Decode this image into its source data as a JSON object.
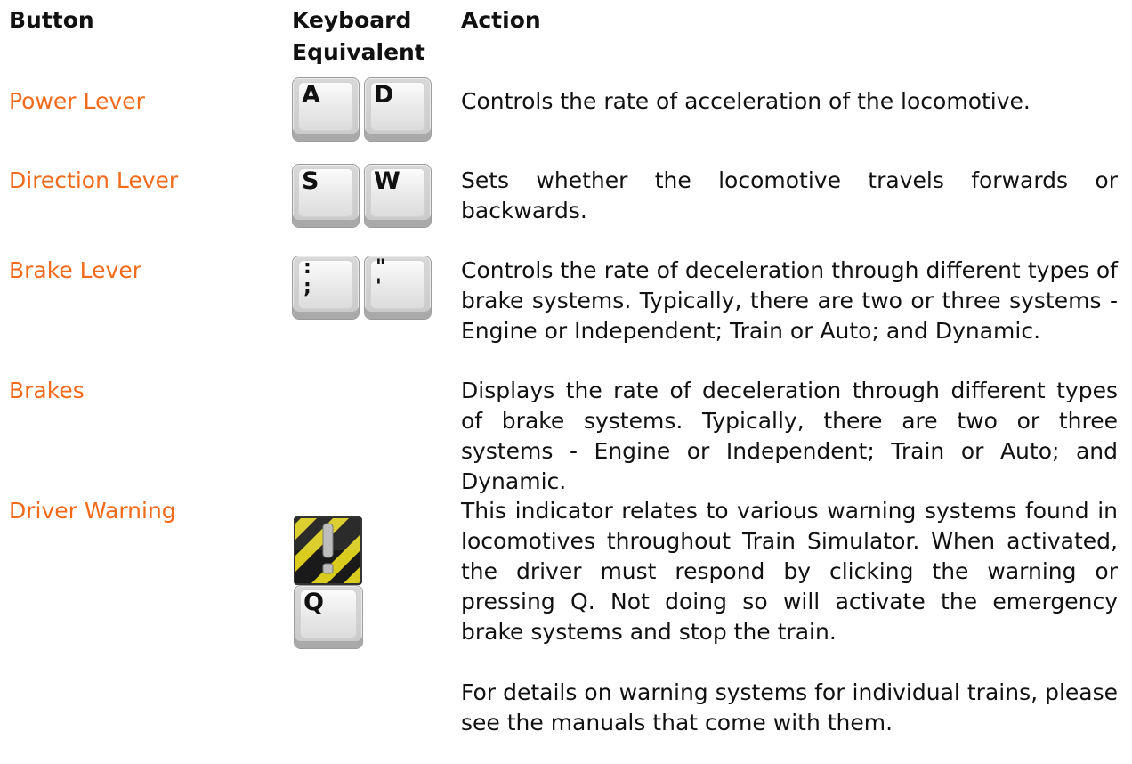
{
  "headers": {
    "button": "Button",
    "keyboard_line1": "Keyboard",
    "keyboard_line2": "Equivalent",
    "action": "Action"
  },
  "rows": [
    {
      "label": "Power Lever",
      "keys": [
        "A",
        "D"
      ],
      "action": "Controls the rate of acceleration of the locomotive."
    },
    {
      "label": "Direction Lever",
      "keys": [
        "S",
        "W"
      ],
      "action": "Sets whether the locomotive travels forwards or backwards."
    },
    {
      "label": "Brake Lever",
      "keys": [
        ":;",
        "\"'"
      ],
      "key_top": [
        ":",
        "\""
      ],
      "key_bottom": [
        ";",
        "'"
      ],
      "action": "Controls the rate of deceleration through different types of brake systems. Typically, there are two or three systems - Engine or Independent; Train or Auto; and Dynamic."
    },
    {
      "label": "Brakes",
      "action": "Displays the rate of deceleration through different types of brake systems. Typically, there are two or three systems - Engine or Independent; Train or Auto; and Dynamic."
    },
    {
      "label": "Driver Warning",
      "keys": [
        "Q"
      ],
      "icon": "driver-warning-icon",
      "action": "This indicator relates to various warning systems found in locomotives throughout Train Simulator. When activated, the driver must respond by clicking the warning or pressing Q. Not doing so will activate the emergency brake systems and stop the train.",
      "action_extra": "For details on warning systems for individual trains, please see the manuals that come with them."
    }
  ],
  "colors": {
    "label": "#f26a1b",
    "text": "#111111",
    "warning_stripe": "#d9cc1f"
  }
}
